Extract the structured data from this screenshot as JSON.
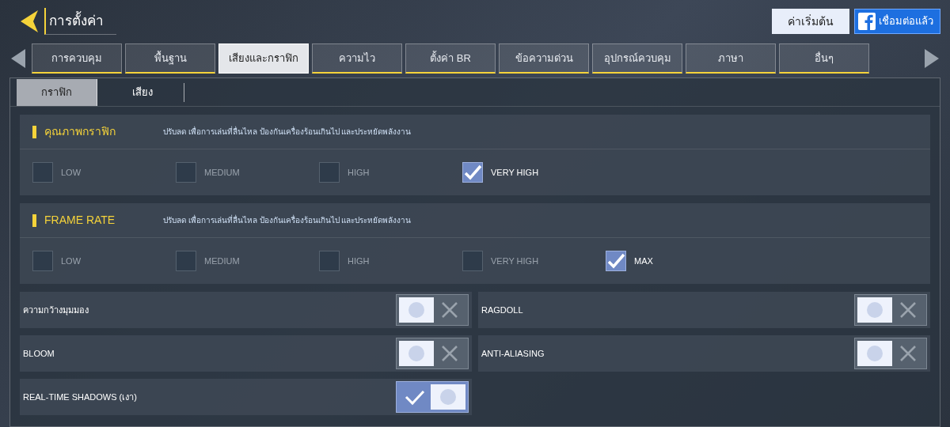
{
  "header": {
    "title": "การตั้งค่า",
    "reset_button": "ค่าเริ่มต้น",
    "facebook_button": "เชื่อมต่อแล้ว"
  },
  "tabs": [
    {
      "label": "การควบคุม",
      "selected": false
    },
    {
      "label": "พื้นฐาน",
      "selected": false
    },
    {
      "label": "เสียงและกราฟิก",
      "selected": true
    },
    {
      "label": "ความไว",
      "selected": false
    },
    {
      "label": "ตั้งค่า BR",
      "selected": false
    },
    {
      "label": "ข้อความด่วน",
      "selected": false
    },
    {
      "label": "อุปกรณ์ควบคุม",
      "selected": false
    },
    {
      "label": "ภาษา",
      "selected": false
    },
    {
      "label": "อื่นๆ",
      "selected": false
    }
  ],
  "subtabs": [
    {
      "label": "กราฟิก",
      "selected": true
    },
    {
      "label": "เสียง",
      "selected": false
    }
  ],
  "sections": [
    {
      "title": "คุณภาพกราฟิก",
      "description": "ปรับลด เพื่อการเล่นที่ลื่นไหล ป้องกันเครื่องร้อนเกินไป และประหยัดพลังงาน",
      "options": [
        {
          "label": "LOW",
          "checked": false
        },
        {
          "label": "MEDIUM",
          "checked": false
        },
        {
          "label": "HIGH",
          "checked": false
        },
        {
          "label": "VERY HIGH",
          "checked": true
        }
      ]
    },
    {
      "title": "FRAME RATE",
      "description": "ปรับลด เพื่อการเล่นที่ลื่นไหล ป้องกันเครื่องร้อนเกินไป และประหยัดพลังงาน",
      "options": [
        {
          "label": "LOW",
          "checked": false
        },
        {
          "label": "MEDIUM",
          "checked": false
        },
        {
          "label": "HIGH",
          "checked": false
        },
        {
          "label": "VERY HIGH",
          "checked": false
        },
        {
          "label": "MAX",
          "checked": true
        }
      ]
    }
  ],
  "toggles": [
    {
      "label": "ความกว้างมุมมอง",
      "on": false
    },
    {
      "label": "RAGDOLL",
      "on": false
    },
    {
      "label": "BLOOM",
      "on": false
    },
    {
      "label": "ANTI-ALIASING",
      "on": false
    },
    {
      "label": "REAL-TIME SHADOWS (เงา)",
      "on": true
    }
  ]
}
